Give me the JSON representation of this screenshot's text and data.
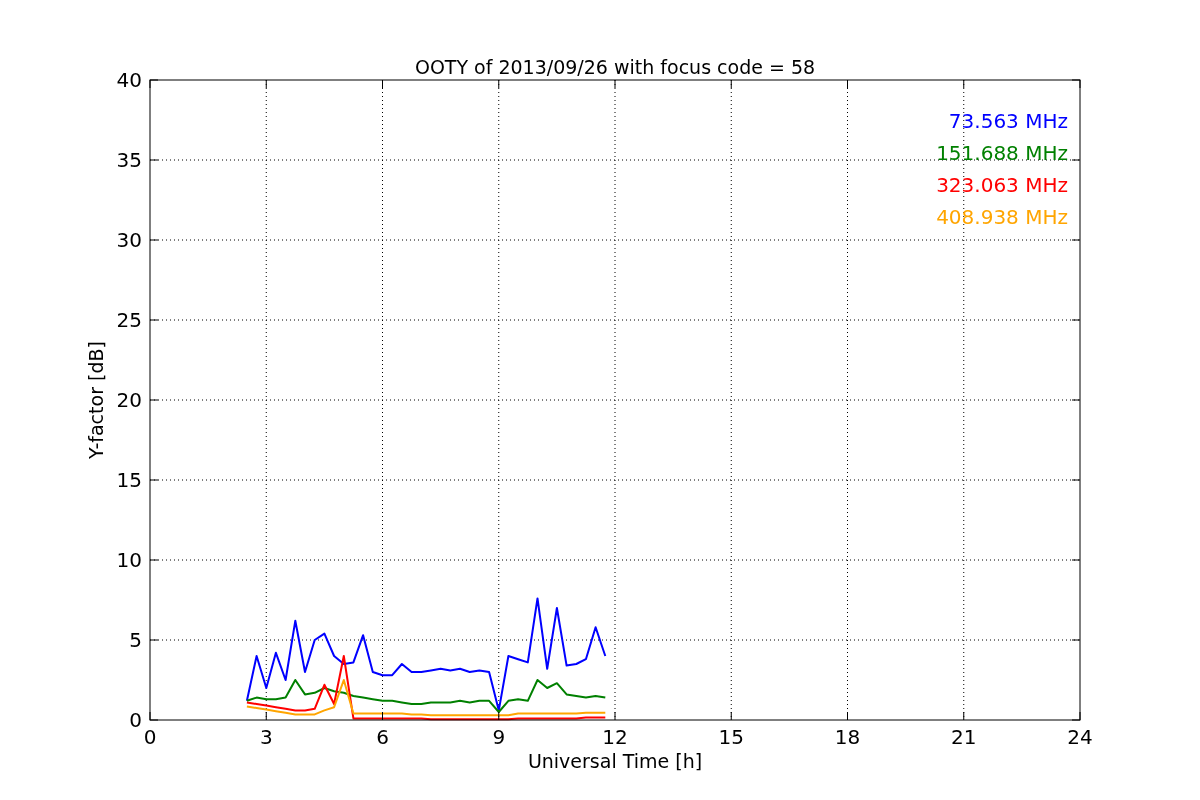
{
  "figure": {
    "chart_data": {
      "type": "line",
      "title": "OOTY of 2013/09/26 with focus code = 58",
      "xlabel": "Universal Time [h]",
      "ylabel": "Y-factor [dB]",
      "grid": true,
      "x": [
        2.5,
        2.75,
        3.0,
        3.25,
        3.5,
        3.75,
        4.0,
        4.25,
        4.5,
        4.75,
        5.0,
        5.25,
        5.5,
        5.75,
        6.0,
        6.25,
        6.5,
        6.75,
        7.0,
        7.25,
        7.5,
        7.75,
        8.0,
        8.25,
        8.5,
        8.75,
        9.0,
        9.25,
        9.5,
        9.75,
        10.0,
        10.25,
        10.5,
        10.75,
        11.0,
        11.25,
        11.5,
        11.75
      ],
      "series": [
        {
          "name": "73.563 MHz",
          "color": "#0000ff",
          "values": [
            1.2,
            4.0,
            2.0,
            4.2,
            2.5,
            6.2,
            3.0,
            5.0,
            5.4,
            4.0,
            3.5,
            3.6,
            5.3,
            3.0,
            2.8,
            2.8,
            3.5,
            3.0,
            3.0,
            3.1,
            3.2,
            3.1,
            3.2,
            3.0,
            3.1,
            3.0,
            0.6,
            4.0,
            3.8,
            3.6,
            7.6,
            3.2,
            7.0,
            3.4,
            3.5,
            3.8,
            5.8,
            4.0
          ]
        },
        {
          "name": "151.688 MHz",
          "color": "#008000",
          "values": [
            1.2,
            1.4,
            1.3,
            1.3,
            1.4,
            2.5,
            1.6,
            1.7,
            2.0,
            1.8,
            1.7,
            1.5,
            1.4,
            1.3,
            1.2,
            1.2,
            1.1,
            1.0,
            1.0,
            1.1,
            1.1,
            1.1,
            1.2,
            1.1,
            1.2,
            1.2,
            0.5,
            1.2,
            1.3,
            1.2,
            2.5,
            2.0,
            2.3,
            1.6,
            1.5,
            1.4,
            1.5,
            1.4
          ]
        },
        {
          "name": "323.063 MHz",
          "color": "#ff0000",
          "values": [
            1.1,
            1.0,
            0.9,
            0.8,
            0.7,
            0.6,
            0.6,
            0.7,
            2.2,
            1.0,
            4.0,
            0.1,
            0.1,
            0.1,
            0.1,
            0.1,
            0.1,
            0.1,
            0.1,
            0.05,
            0.05,
            0.05,
            0.05,
            0.05,
            0.05,
            0.05,
            0.05,
            0.05,
            0.1,
            0.1,
            0.1,
            0.1,
            0.1,
            0.1,
            0.1,
            0.15,
            0.15,
            0.15
          ]
        },
        {
          "name": "408.938 MHz",
          "color": "#ffa500",
          "values": [
            0.85,
            0.75,
            0.65,
            0.55,
            0.45,
            0.35,
            0.35,
            0.35,
            0.6,
            0.8,
            2.5,
            0.4,
            0.4,
            0.4,
            0.4,
            0.4,
            0.4,
            0.35,
            0.35,
            0.3,
            0.3,
            0.3,
            0.3,
            0.3,
            0.3,
            0.3,
            0.3,
            0.3,
            0.4,
            0.4,
            0.4,
            0.4,
            0.4,
            0.4,
            0.4,
            0.45,
            0.45,
            0.45
          ]
        }
      ],
      "xlim": [
        0,
        24
      ],
      "ylim": [
        0,
        40
      ],
      "xticks": [
        0,
        3,
        6,
        9,
        12,
        15,
        18,
        21,
        24
      ],
      "yticks": [
        0,
        5,
        10,
        15,
        20,
        25,
        30,
        35,
        40
      ]
    }
  }
}
